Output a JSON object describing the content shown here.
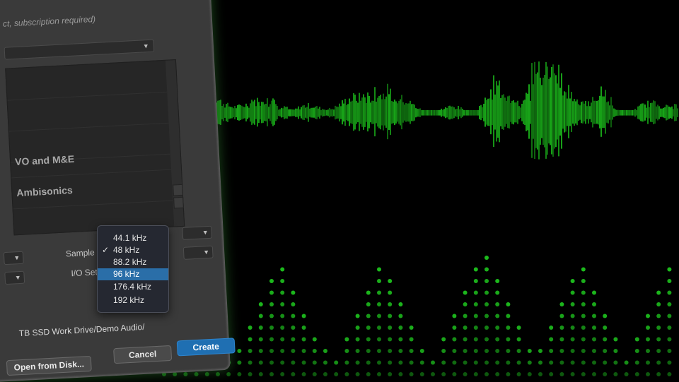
{
  "dialog": {
    "subtext": "ct, subscription required)",
    "list_rows": [
      "VO and M&E",
      "Ambisonics"
    ],
    "sample_rate_label": "Sample Rate:",
    "io_settings_label": "I/O Settings:",
    "path_text": "TB SSD Work Drive/Demo Audio/",
    "buttons": {
      "open_from_disk": "Open from Disk...",
      "cancel": "Cancel",
      "create": "Create"
    }
  },
  "sample_rate_menu": {
    "options": [
      "44.1 kHz",
      "48 kHz",
      "88.2 kHz",
      "96 kHz",
      "176.4 kHz",
      "192 kHz"
    ],
    "checked": "48 kHz",
    "highlighted": "96 kHz",
    "check_glyph": "✓"
  },
  "colors": {
    "waveform": "#1fd01f",
    "meter_dot": "#1ec41e",
    "accent_blue": "#1f6fb2"
  }
}
